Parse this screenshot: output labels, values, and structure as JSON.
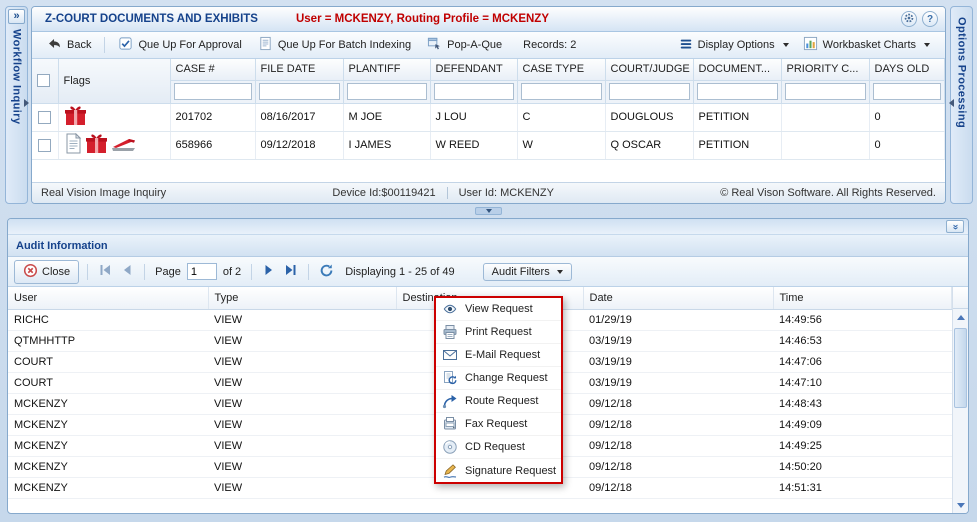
{
  "left_panel": {
    "title": "Workflow Inquiry"
  },
  "right_panel": {
    "title": "Options Processing"
  },
  "documents_panel": {
    "title": "Z-COURT DOCUMENTS AND EXHIBITS",
    "user_info": "User = MCKENZY, Routing Profile = MCKENZY",
    "toolbar": {
      "back_label": "Back",
      "que_approval_label": "Que Up For Approval",
      "que_batch_label": "Que Up For Batch Indexing",
      "pop_a_que_label": "Pop-A-Que",
      "records_label": "Records: 2",
      "display_options_label": "Display Options",
      "workbasket_charts_label": "Workbasket Charts"
    },
    "grid": {
      "flags_header": "Flags",
      "columns": [
        "CASE #",
        "FILE DATE",
        "PLANTIFF",
        "DEFENDANT",
        "CASE TYPE",
        "COURT/JUDGE",
        "DOCUMENT...",
        "PRIORITY C...",
        "DAYS OLD"
      ],
      "rows": [
        {
          "flags": [
            "gift-icon"
          ],
          "case_number": "201702",
          "file_date": "08/16/2017",
          "plantiff": "M JOE",
          "defendant": "J LOU",
          "case_type": "C",
          "court_judge": "DOUGLOUS",
          "document_type": "PETITION",
          "priority_code": "",
          "days_old": "0"
        },
        {
          "flags": [
            "document-icon",
            "gift-icon",
            "stapler-icon"
          ],
          "case_number": "658966",
          "file_date": "09/12/2018",
          "plantiff": "I JAMES",
          "defendant": "W REED",
          "case_type": "W",
          "court_judge": "Q OSCAR",
          "document_type": "PETITION",
          "priority_code": "",
          "days_old": "0"
        }
      ]
    },
    "status_bar": {
      "app_name": "Real Vision Image Inquiry",
      "device_id": "Device Id:$00119421",
      "user_id": "User Id: MCKENZY",
      "copyright": "© Real Vison Software. All Rights Reserved."
    }
  },
  "audit_panel": {
    "title": "Audit Information",
    "toolbar": {
      "close_label": "Close",
      "page_label": "Page",
      "page_value": "1",
      "page_of_label": "of 2",
      "displaying_label": "Displaying 1 - 25 of 49",
      "audit_filters_label": "Audit Filters"
    },
    "columns": [
      "User",
      "Type",
      "Destination",
      "Date",
      "Time"
    ],
    "rows": [
      {
        "user": "RICHC",
        "type": "VIEW",
        "destination": "",
        "date": "01/29/19",
        "time": "14:49:56"
      },
      {
        "user": "QTMHHTTP",
        "type": "VIEW",
        "destination": "",
        "date": "03/19/19",
        "time": "14:46:53"
      },
      {
        "user": "COURT",
        "type": "VIEW",
        "destination": "",
        "date": "03/19/19",
        "time": "14:47:06"
      },
      {
        "user": "COURT",
        "type": "VIEW",
        "destination": "",
        "date": "03/19/19",
        "time": "14:47:10"
      },
      {
        "user": "MCKENZY",
        "type": "VIEW",
        "destination": "",
        "date": "09/12/18",
        "time": "14:48:43"
      },
      {
        "user": "MCKENZY",
        "type": "VIEW",
        "destination": "",
        "date": "09/12/18",
        "time": "14:49:09"
      },
      {
        "user": "MCKENZY",
        "type": "VIEW",
        "destination": "",
        "date": "09/12/18",
        "time": "14:49:25"
      },
      {
        "user": "MCKENZY",
        "type": "VIEW",
        "destination": "",
        "date": "09/12/18",
        "time": "14:50:20"
      },
      {
        "user": "MCKENZY",
        "type": "VIEW",
        "destination": "",
        "date": "09/12/18",
        "time": "14:51:31"
      }
    ],
    "filter_menu": {
      "items": [
        {
          "icon": "eye-icon",
          "label": "View Request"
        },
        {
          "icon": "printer-icon",
          "label": "Print Request"
        },
        {
          "icon": "envelope-icon",
          "label": "E-Mail Request"
        },
        {
          "icon": "change-icon",
          "label": "Change Request"
        },
        {
          "icon": "route-icon",
          "label": "Route Request"
        },
        {
          "icon": "fax-icon",
          "label": "Fax Request"
        },
        {
          "icon": "cd-icon",
          "label": "CD Request"
        },
        {
          "icon": "signature-icon",
          "label": "Signature Request"
        }
      ]
    }
  }
}
